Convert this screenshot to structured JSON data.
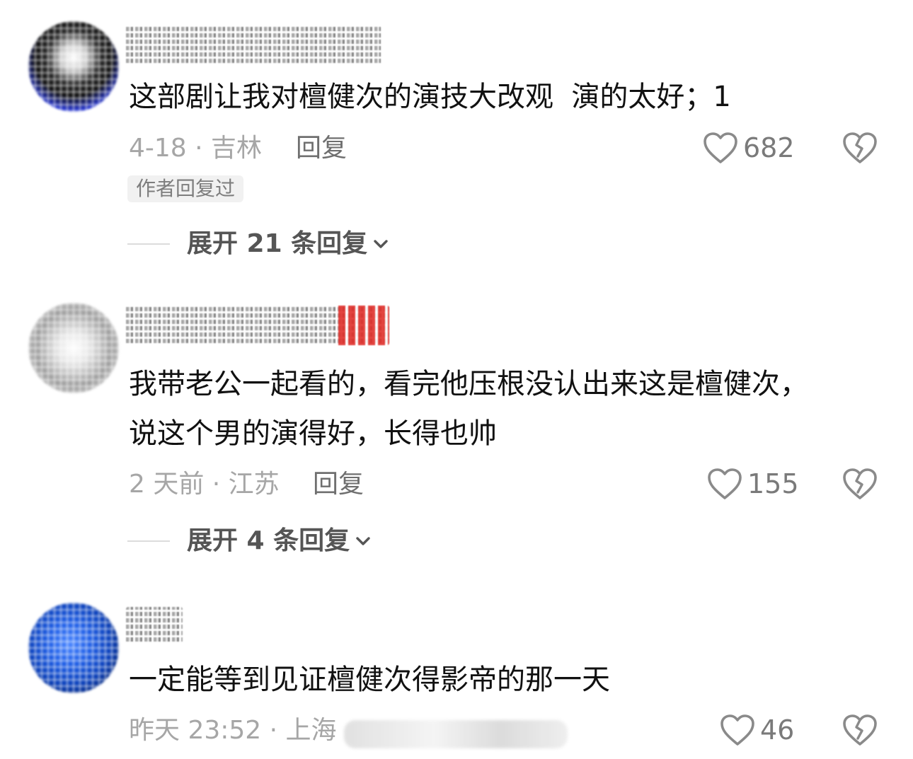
{
  "comments": [
    {
      "text": "这部剧让我对檀健次的演技大改观  演的太好；1",
      "meta": "4-18 · 吉林",
      "reply_label": "回复",
      "likes": "682",
      "author_tag": "作者回复过",
      "expand_label": "展开 21 条回复",
      "avatar_style": "dark"
    },
    {
      "text_line1": "我带老公一起看的，看完他压根没认出来这是檀健次，",
      "text_line2": "说这个男的演得好，长得也帅",
      "meta": "2 天前 · 江苏",
      "reply_label": "回复",
      "likes": "155",
      "expand_label": "展开 4 条回复",
      "avatar_style": "gray"
    },
    {
      "text": "一定能等到见证檀健次得影帝的那一天",
      "meta": "昨天 23:52 · 上海",
      "likes": "46",
      "avatar_style": "blue"
    }
  ],
  "icons": {
    "like": "heart-outline-icon",
    "dislike": "broken-heart-icon",
    "expand": "chevron-down-icon"
  },
  "colors": {
    "text": "#111111",
    "meta": "#a6a6a6",
    "reply": "#6f6f6f",
    "count": "#7a7a7a",
    "tag_bg": "#f1f1f1",
    "icon": "#8a8a8a"
  }
}
